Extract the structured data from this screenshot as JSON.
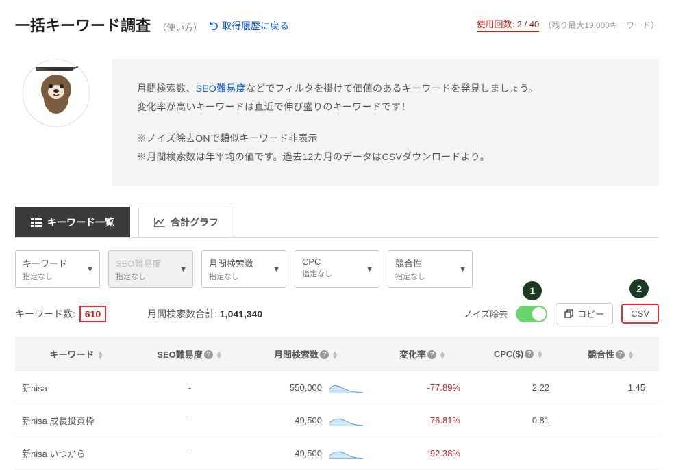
{
  "header": {
    "title": "一括キーワード調査",
    "howto": "（使い方）",
    "back_label": "取得履歴に戻る",
    "usage_label": "使用回数:",
    "usage_count": "2 / 40",
    "usage_remaining": "（残り最大19,000キーワード）"
  },
  "bubble": {
    "p1_prefix": "月間検索数、",
    "p1_link": "SEO難易度",
    "p1_suffix": "などでフィルタを掛けて価値のあるキーワードを発見しましょう。",
    "p2": "変化率が高いキーワードは直近で伸び盛りのキーワードです！",
    "p3": "※ノイズ除去ONで類似キーワード非表示",
    "p4": "※月間検索数は年平均の値です。過去12カ月のデータはCSVダウンロードより。"
  },
  "tabs": {
    "list": "キーワード一覧",
    "graph": "合計グラフ"
  },
  "filters": [
    {
      "name": "キーワード",
      "value": "指定なし"
    },
    {
      "name": "SEO難易度",
      "value": "指定なし"
    },
    {
      "name": "月間検索数",
      "value": "指定なし"
    },
    {
      "name": "CPC",
      "value": "指定なし"
    },
    {
      "name": "競合性",
      "value": "指定なし"
    }
  ],
  "stats": {
    "kw_count_label": "キーワード数:",
    "kw_count": "610",
    "sum_label": "月間検索数合計:",
    "sum_value": "1,041,340",
    "noise_label": "ノイズ除去",
    "copy_label": "コピー",
    "csv_label": "CSV",
    "annot1": "1",
    "annot2": "2"
  },
  "table": {
    "headers": [
      "キーワード",
      "SEO難易度",
      "月間検索数",
      "変化率",
      "CPC($)",
      "競合性"
    ],
    "rows": [
      {
        "kw": "新nisa",
        "diff": "-",
        "vol": "550,000",
        "change": "-77.89%",
        "cpc": "2.22",
        "comp": "1.45"
      },
      {
        "kw": "新nisa 成長投資枠",
        "diff": "-",
        "vol": "49,500",
        "change": "-76.81%",
        "cpc": "0.81",
        "comp": ""
      },
      {
        "kw": "新nisa いつから",
        "diff": "-",
        "vol": "49,500",
        "change": "-92.38%",
        "cpc": "",
        "comp": ""
      }
    ]
  },
  "chart_data": {
    "type": "table",
    "title": "一括キーワード調査結果",
    "columns": [
      "キーワード",
      "SEO難易度",
      "月間検索数",
      "変化率(%)",
      "CPC($)",
      "競合性"
    ],
    "rows": [
      [
        "新nisa",
        null,
        550000,
        -77.89,
        2.22,
        1.45
      ],
      [
        "新nisa 成長投資枠",
        null,
        49500,
        -76.81,
        0.81,
        null
      ],
      [
        "新nisa いつから",
        null,
        49500,
        -92.38,
        null,
        null
      ]
    ],
    "summary": {
      "keyword_count": 610,
      "monthly_volume_total": 1041340
    }
  }
}
